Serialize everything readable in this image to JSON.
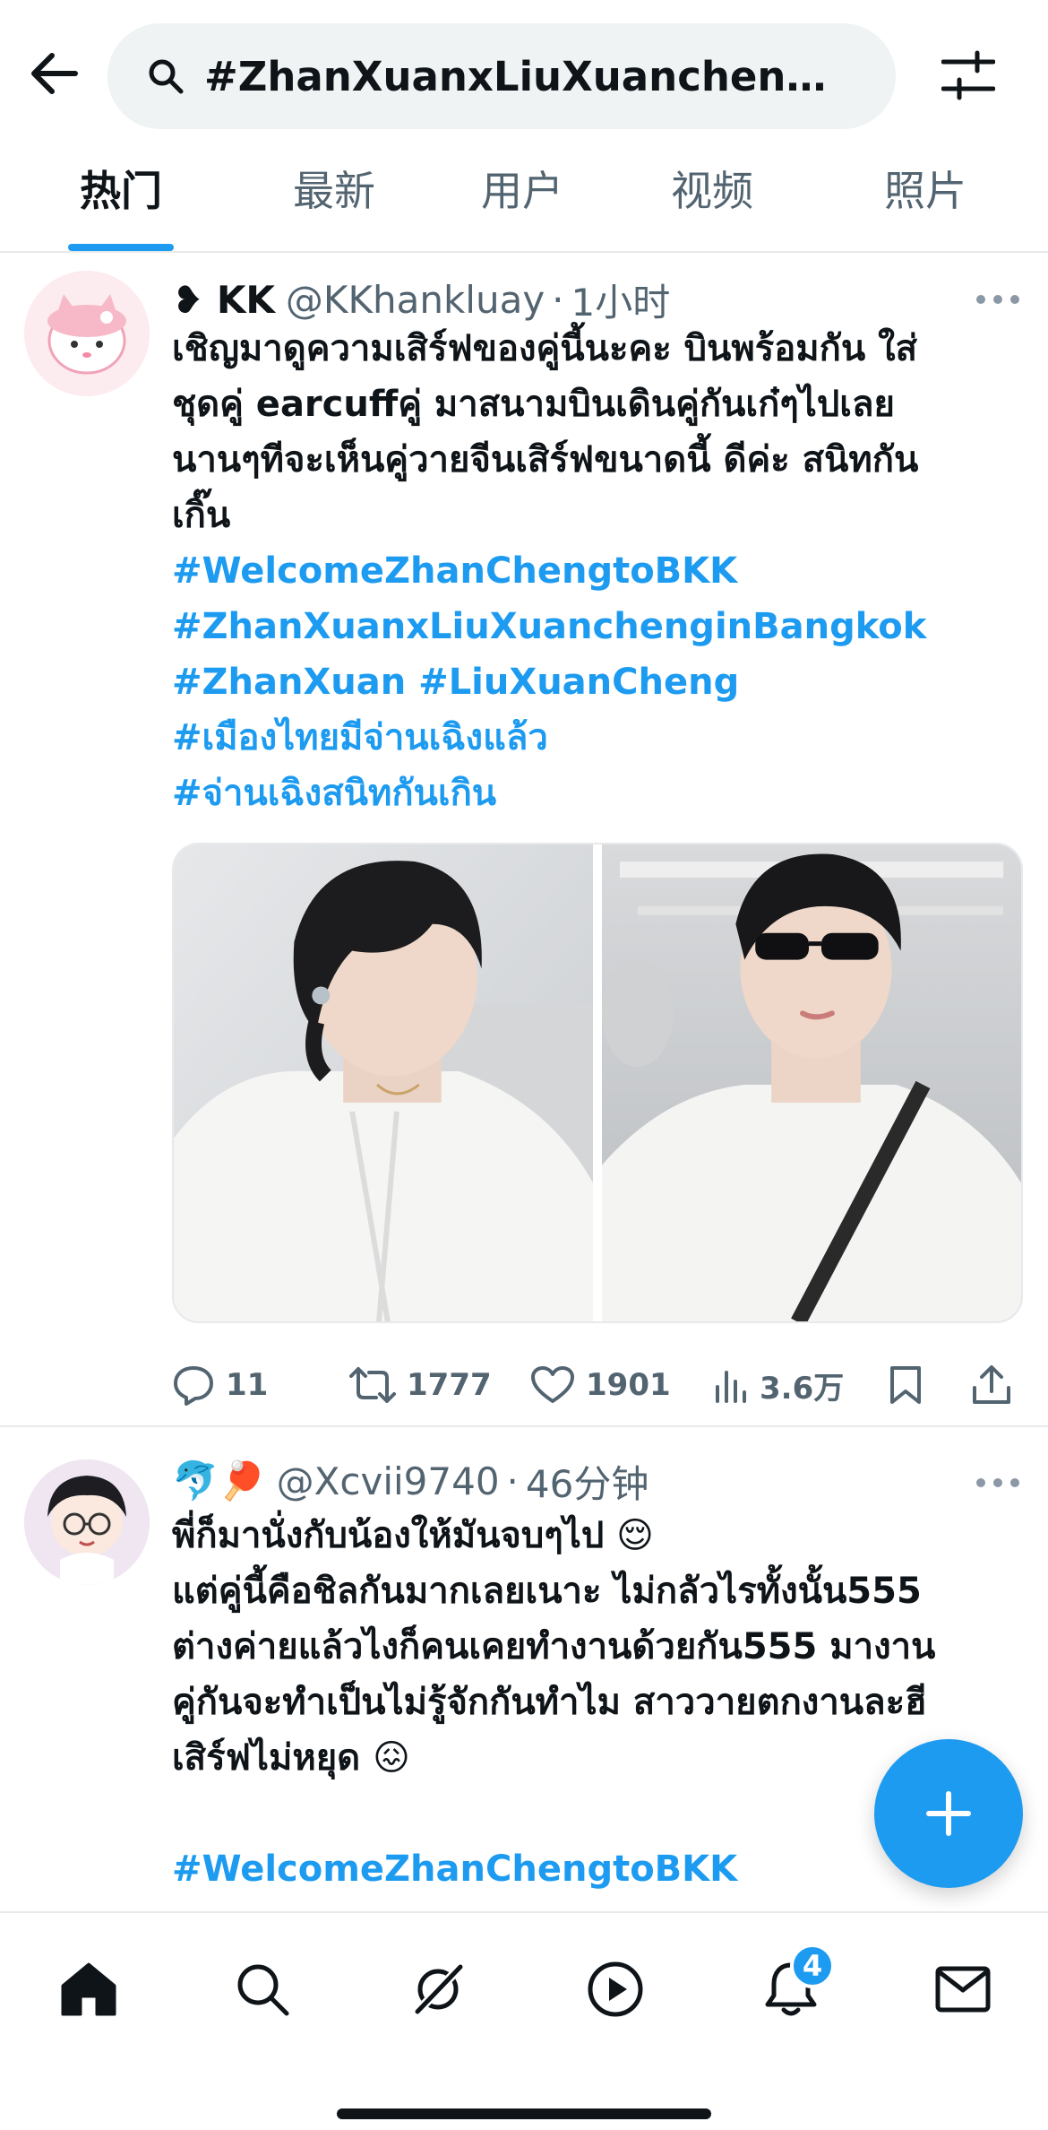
{
  "header": {
    "search_query": "#ZhanXuanxLiuXuanchengi...",
    "tabs": [
      {
        "label": "热门",
        "active": true
      },
      {
        "label": "最新",
        "active": false
      },
      {
        "label": "用户",
        "active": false
      },
      {
        "label": "视频",
        "active": false
      },
      {
        "label": "照片",
        "active": false
      }
    ]
  },
  "tweets": [
    {
      "display_name": "❥ KK",
      "handle": "@KKhankluay",
      "time": "1小时",
      "text_lines": [
        "เชิญมาดูความเสิร์ฟของคู่นี้นะคะ บินพร้อมกัน ใส่",
        "ชุดคู่ earcuffคู่ มาสนามบินเดินคู่กันเก๋ๆไปเลย",
        "นานๆทีจะเห็นคู่วายจีนเสิร์ฟขนาดนี้ ดีค่ะ สนิทกัน",
        "เกิ๊น"
      ],
      "hashtags": [
        "#WelcomeZhanChengtoBKK",
        "#ZhanXuanxLiuXuanchenginBangkok",
        "#ZhanXuan #LiuXuanCheng",
        "#เมืองไทยมีจ่านเฉิงแล้ว",
        "#จ่านเฉิงสนิทกันเกิน"
      ],
      "stats": {
        "replies": "11",
        "reposts": "1777",
        "likes": "1901",
        "views": "3.6万"
      }
    },
    {
      "display_name": "🐬🏓",
      "handle": "@Xcvii9740",
      "time": "46分钟",
      "text_lines": [
        "พี่ก็มานั่งกับน้องให้มันจบๆไป 😌",
        "แต่คู่นี้คือชิลกันมากเลยเนาะ ไม่กลัวไรทั้งนั้น555",
        "ต่างค่ายแล้วไงก็คนเคยทำงานด้วยกัน555 มางาน",
        "คู่กันจะทำเป็นไม่รู้จักกันทำไม สาววายตกงานละฮี",
        "เสิร์ฟไม่หยุด 😖"
      ],
      "hashtags": [
        "#WelcomeZhanChengtoBKK"
      ]
    }
  ],
  "bottom_nav": {
    "notifications_badge": "4"
  },
  "colors": {
    "accent": "#1d9bf0",
    "text_primary": "#0f1419",
    "text_secondary": "#536471"
  }
}
